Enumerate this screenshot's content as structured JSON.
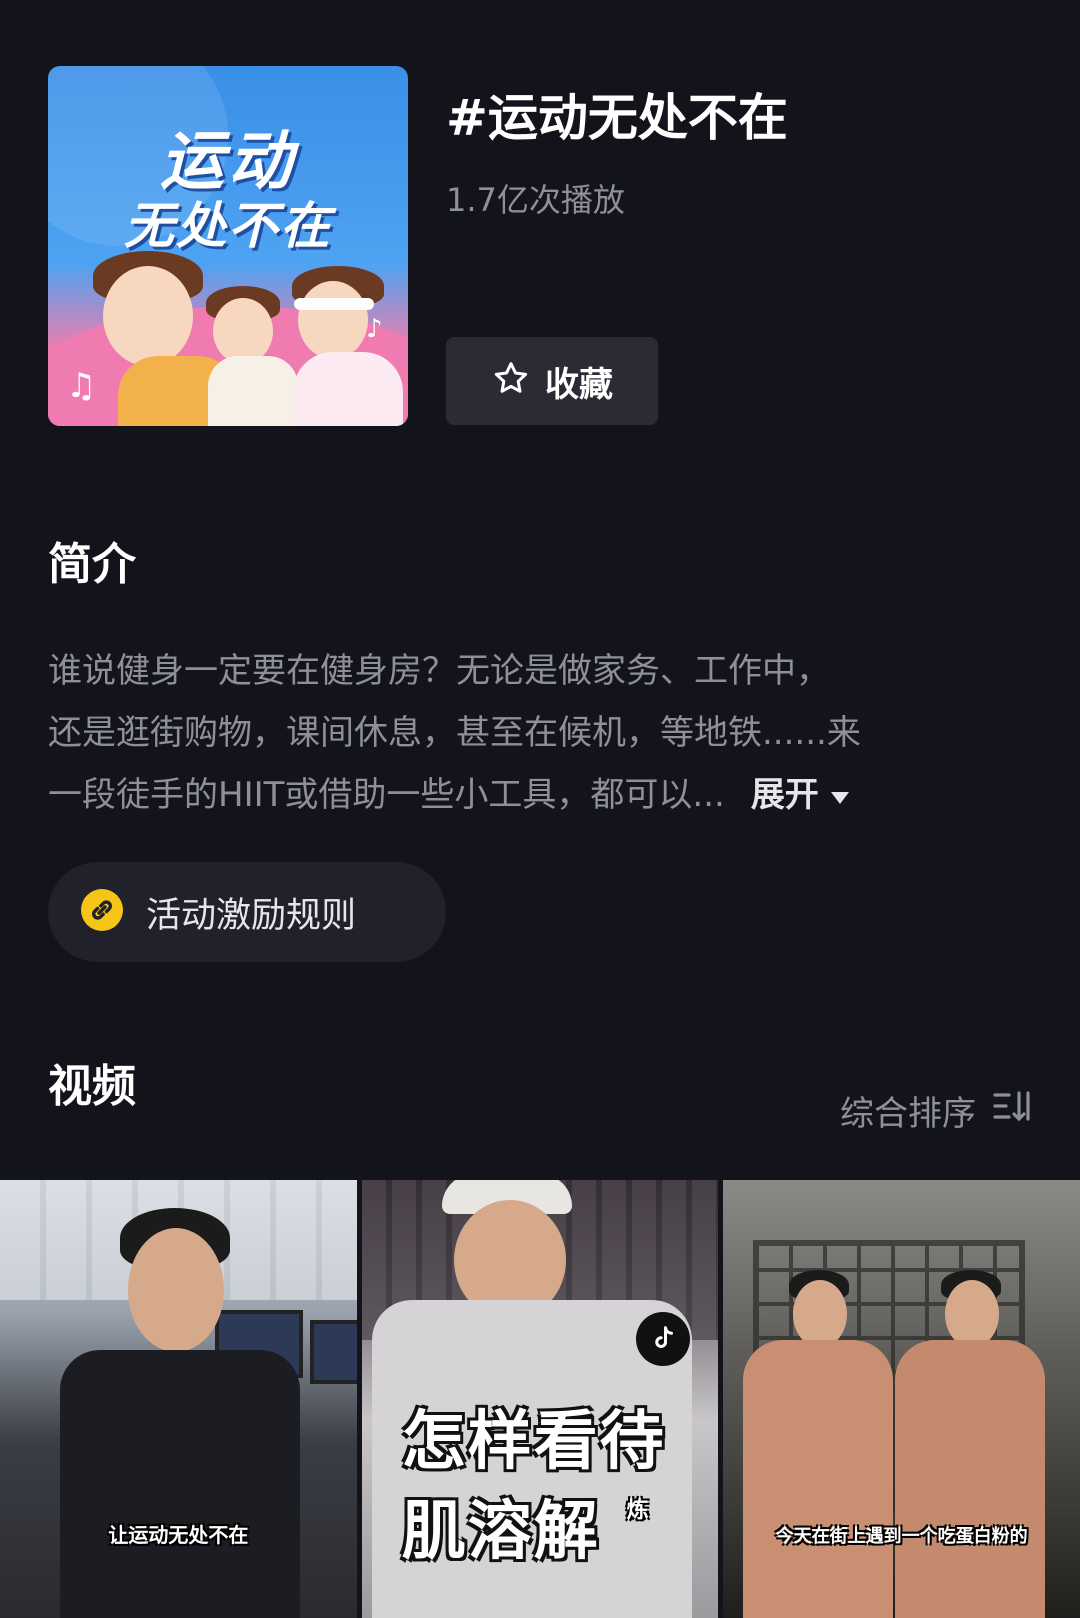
{
  "topic": {
    "cover_line1": "运动",
    "cover_line2": "无处不在",
    "title": "#运动无处不在",
    "plays": "1.7亿次播放",
    "favorite_label": "收藏"
  },
  "intro": {
    "heading": "简介",
    "line1": "谁说健身一定要在健身房？无论是做家务、工作中，",
    "line2": "还是逛街购物，课间休息，甚至在候机，等地铁......来",
    "line3": "一段徒手的HIIT或借助一些小工具，都可以...",
    "expand_label": "展开"
  },
  "rules": {
    "label": "活动激励规则"
  },
  "videos": {
    "heading": "视频",
    "sort_label": "综合排序",
    "items": [
      {
        "caption": "让运动无处不在"
      },
      {
        "caption_line1": "怎样看待",
        "caption_line2": "肌溶解",
        "caption_mini": "炼"
      },
      {
        "caption": "今天在街上遇到一个吃蛋白粉的"
      }
    ]
  },
  "colors": {
    "background": "#13131c",
    "muted_text": "#8e8f99",
    "button_bg": "#2a2b35",
    "accent_yellow": "#f5c518"
  },
  "icons": {
    "favorite": "star-outline-icon",
    "expand": "caret-down-icon",
    "rules": "link-icon",
    "sort": "sort-icon",
    "video_badge": "tiktok-logo-icon"
  }
}
